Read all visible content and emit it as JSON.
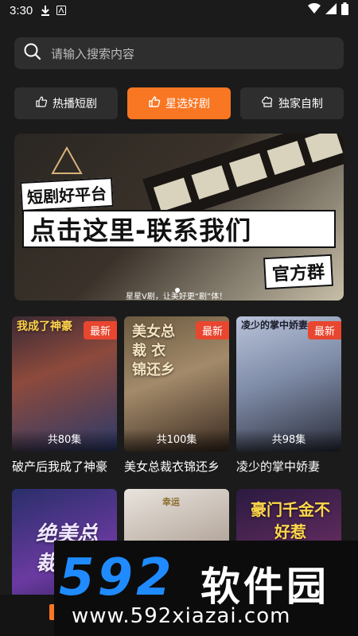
{
  "status": {
    "time": "3:30"
  },
  "search": {
    "placeholder": "请输入搜索内容"
  },
  "tabs": [
    {
      "label": "热播短剧",
      "active": false,
      "icon": "thumb-icon"
    },
    {
      "label": "星选好剧",
      "active": true,
      "icon": "thumb-up-icon"
    },
    {
      "label": "独家自制",
      "active": false,
      "icon": "chef-hat-icon"
    }
  ],
  "banner": {
    "line1": "短剧好平台",
    "line2": "点击这里-联系我们",
    "line3": "官方群",
    "line4": "星星V剧，让美好更“剧”体！"
  },
  "dramas": [
    {
      "title": "破产后我成了神豪",
      "badge": "最新",
      "episodes": "共80集",
      "poster_text": "我成了神豪"
    },
    {
      "title": "美女总裁衣锦还乡",
      "badge": "最新",
      "episodes": "共100集",
      "poster_text": "美女总裁 衣锦还乡"
    },
    {
      "title": "凌少的掌中娇妻",
      "badge": "最新",
      "episodes": "共98集",
      "poster_text": "凌少的掌中娇妻"
    },
    {
      "title": "",
      "badge": "",
      "episodes": "",
      "poster_text": "绝美总裁"
    },
    {
      "title": "",
      "badge": "",
      "episodes": "",
      "poster_text": "幸运"
    },
    {
      "title": "",
      "badge": "",
      "episodes": "",
      "poster_text": "豪门千金不好惹"
    }
  ],
  "watermark": {
    "logo": "592",
    "name": "软件园",
    "url": "www.592xiazai.com"
  },
  "colors": {
    "accent": "#f97623",
    "badge": "#e8462f",
    "background": "#1b1b1b",
    "surface": "#2e2e2e",
    "watermark_blue": "#1f8bff"
  }
}
